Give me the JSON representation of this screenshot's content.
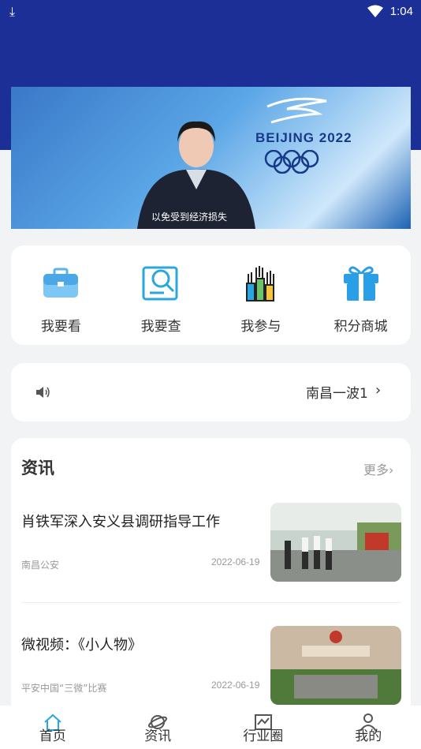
{
  "status_bar": {
    "time": "1:04",
    "download_icon": "download-icon",
    "wifi_icon": "wifi-icon"
  },
  "banner": {
    "brand": "BEIJING 2022",
    "caption": "以免受到经济损失"
  },
  "menu": {
    "items": [
      {
        "label": "我要看",
        "icon": "briefcase-icon"
      },
      {
        "label": "我要查",
        "icon": "search-document-icon"
      },
      {
        "label": "我参与",
        "icon": "raised-hands-icon"
      },
      {
        "label": "积分商城",
        "icon": "gift-icon"
      }
    ]
  },
  "notice": {
    "text": "南昌一波1",
    "chevron": "›",
    "icon": "speaker-icon"
  },
  "news": {
    "title": "资讯",
    "more": "更多›",
    "articles": [
      {
        "title": "肖铁军深入安义县调研指导工作",
        "source": "南昌公安",
        "date": "2022-06-19"
      },
      {
        "title": "微视频：《小人物》",
        "source": "平安中国“三微”比赛",
        "date": "2022-06-19"
      }
    ]
  },
  "tabbar": {
    "tabs": [
      {
        "label": "首页",
        "icon": "home-icon"
      },
      {
        "label": "资讯",
        "icon": "planet-icon"
      },
      {
        "label": "行业圈",
        "icon": "chart-icon"
      },
      {
        "label": "我的",
        "icon": "user-icon"
      }
    ]
  },
  "colors": {
    "header": "#1b2f97",
    "accent": "#2aa7e0",
    "background": "#f2f3f5"
  }
}
